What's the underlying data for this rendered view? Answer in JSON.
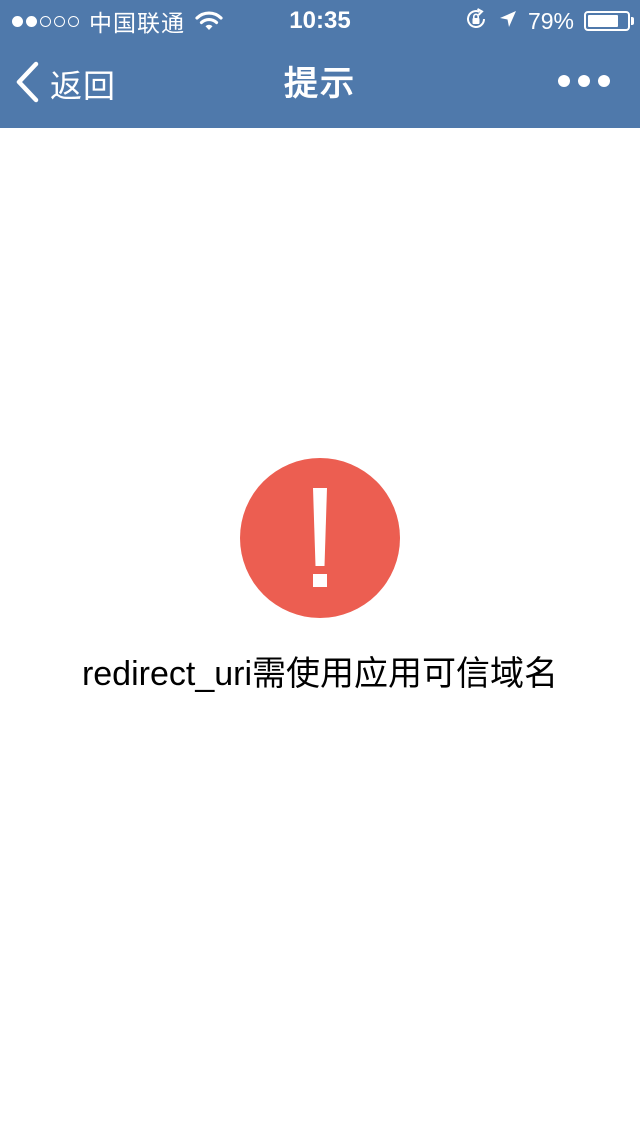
{
  "status_bar": {
    "signal_dots_filled": 2,
    "signal_dots_total": 5,
    "carrier": "中国联通",
    "time": "10:35",
    "battery_percent": "79%",
    "battery_level": 0.79
  },
  "nav": {
    "back_label": "返回",
    "title": "提示"
  },
  "content": {
    "message": "redirect_uri需使用应用可信域名"
  },
  "colors": {
    "nav_background": "#4f79ab",
    "error_circle": "#ec5e51"
  },
  "icons": {
    "back": "chevron-left-icon",
    "more": "more-dots-icon",
    "error": "exclamation-circle-icon",
    "wifi": "wifi-icon",
    "rotation_lock": "rotation-lock-icon",
    "location": "location-arrow-icon",
    "battery": "battery-icon"
  }
}
